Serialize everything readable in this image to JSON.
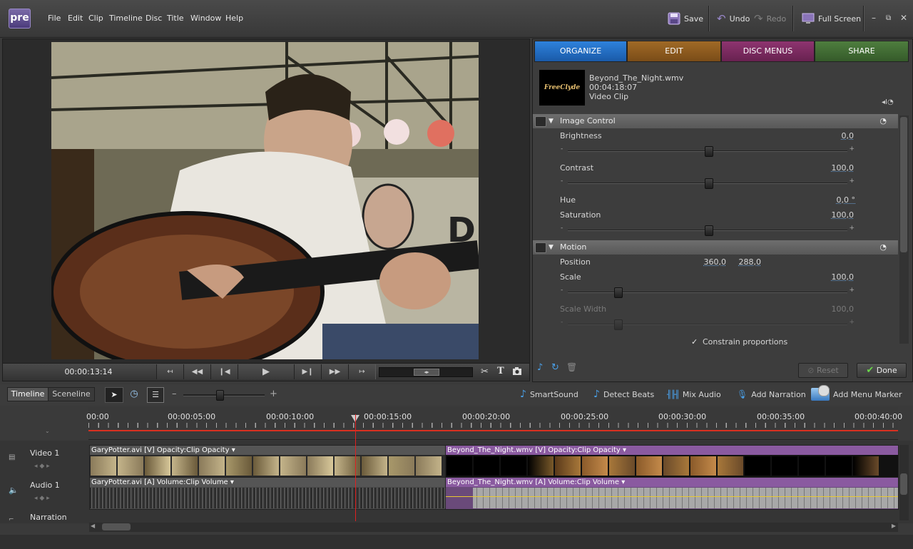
{
  "app": {
    "logo": "pre"
  },
  "menu": [
    "File",
    "Edit",
    "Clip",
    "Timeline",
    "Disc",
    "Title",
    "Window",
    "Help"
  ],
  "toolbar": {
    "save": "Save",
    "undo": "Undo",
    "redo": "Redo",
    "fullscreen": "Full Screen"
  },
  "monitor": {
    "timecode": "00:00:13:14"
  },
  "tabs": [
    {
      "label": "ORGANIZE",
      "color": "#1f6ac0"
    },
    {
      "label": "EDIT",
      "color": "#8b5a1e"
    },
    {
      "label": "DISC MENUS",
      "color": "#7a2a5e"
    },
    {
      "label": "SHARE",
      "color": "#3e6a32"
    }
  ],
  "clip": {
    "thumb_text": "FreeClyde",
    "name": "Beyond_The_Night.wmv",
    "duration": "00:04:18:07",
    "type": "Video Clip"
  },
  "image_control": {
    "title": "Image Control",
    "brightness": {
      "label": "Brightness",
      "value": "0,0",
      "level": 0.5
    },
    "contrast": {
      "label": "Contrast",
      "value": "100,0",
      "level": 0.5
    },
    "hue": {
      "label": "Hue",
      "value": "0,0 °"
    },
    "saturation": {
      "label": "Saturation",
      "value": "100,0",
      "level": 0.5
    }
  },
  "motion": {
    "title": "Motion",
    "position": {
      "label": "Position",
      "x": "360,0",
      "y": "288,0"
    },
    "scale": {
      "label": "Scale",
      "value": "100,0",
      "level": 0.18
    },
    "scale_width": {
      "label": "Scale Width",
      "value": "100,0",
      "level": 0.18
    },
    "constrain": "Constrain proportions"
  },
  "panel_buttons": {
    "reset": "Reset",
    "done": "Done"
  },
  "timeline": {
    "tabs": [
      "Timeline",
      "Sceneline"
    ],
    "tools": [
      "SmartSound",
      "Detect Beats",
      "Mix Audio",
      "Add Narration",
      "Add Menu Marker"
    ],
    "ruler": [
      "00:00",
      "00:00:05:00",
      "00:00:10:00",
      "00:00:15:00",
      "00:00:20:00",
      "00:00:25:00",
      "00:00:30:00",
      "00:00:35:00",
      "00:00:40:00"
    ],
    "tracks": [
      "Video 1",
      "Audio 1",
      "Narration"
    ],
    "clips": {
      "v1a": "GaryPotter.avi [V]  Opacity:Clip Opacity ▾",
      "v1b": "Beyond_The_Night.wmv [V]  Opacity:Clip Opacity ▾",
      "a1a": "GaryPotter.avi [A]  Volume:Clip Volume ▾",
      "a1b": "Beyond_The_Night.wmv [A]  Volume:Clip Volume ▾"
    }
  }
}
